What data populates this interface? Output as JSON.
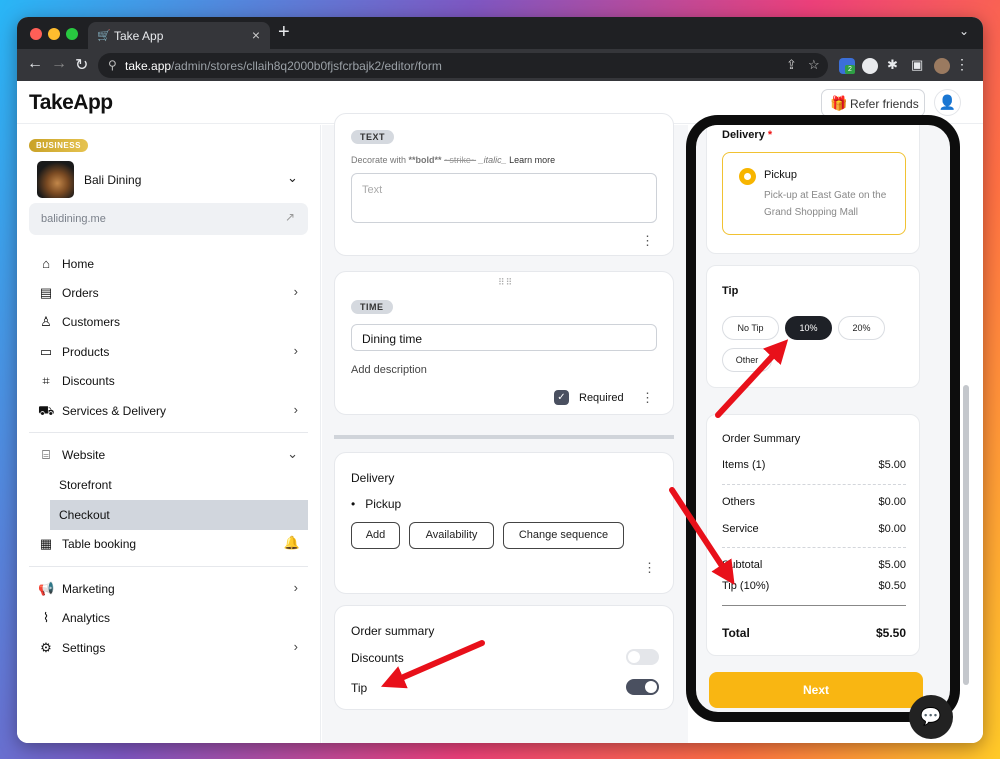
{
  "browser": {
    "tab_title": "Take App",
    "url_host": "take.app",
    "url_path": "/admin/stores/cllaih8q2000b0fjsfcrbajk2/editor/form",
    "new_tab": "+",
    "ext_badge": "2"
  },
  "header": {
    "logo": "TakeApp",
    "refer_label": "Refer friends"
  },
  "sidebar": {
    "plan_badge": "BUSINESS",
    "store_name": "Bali Dining",
    "store_domain": "balidining.me",
    "items": [
      {
        "label": "Home",
        "icon": "home-icon"
      },
      {
        "label": "Orders",
        "icon": "orders-icon"
      },
      {
        "label": "Customers",
        "icon": "person-icon"
      },
      {
        "label": "Products",
        "icon": "box-icon"
      },
      {
        "label": "Discounts",
        "icon": "tag-icon"
      },
      {
        "label": "Services & Delivery",
        "icon": "truck-icon"
      },
      {
        "label": "Website",
        "icon": "store-icon"
      },
      {
        "label": "Storefront"
      },
      {
        "label": "Checkout"
      },
      {
        "label": "Table booking",
        "icon": "calendar-icon"
      },
      {
        "label": "Marketing",
        "icon": "megaphone-icon"
      },
      {
        "label": "Analytics",
        "icon": "chart-icon"
      },
      {
        "label": "Settings",
        "icon": "gear-icon"
      }
    ]
  },
  "editor": {
    "text_card": {
      "chip": "TEXT",
      "hint_prefix": "Decorate with",
      "hint_bold": "**bold**",
      "hint_strike": "~strike~",
      "hint_italic": "_italic_",
      "hint_link": "Learn more",
      "placeholder": "Text"
    },
    "time_card": {
      "chip": "TIME",
      "value": "Dining time",
      "add_description": "Add description",
      "required_label": "Required"
    },
    "delivery_card": {
      "title": "Delivery",
      "option": "Pickup",
      "buttons": [
        "Add",
        "Availability",
        "Change sequence"
      ]
    },
    "summary_card": {
      "title": "Order summary",
      "rows": [
        {
          "label": "Discounts",
          "enabled": false
        },
        {
          "label": "Tip",
          "enabled": true
        }
      ]
    }
  },
  "preview": {
    "delivery": {
      "title": "Delivery",
      "required_mark": "*",
      "option_name": "Pickup",
      "option_desc": "Pick-up at East Gate on the Grand Shopping Mall"
    },
    "tip": {
      "title": "Tip",
      "options": [
        "No Tip",
        "10%",
        "20%",
        "Other"
      ],
      "selected": "10%"
    },
    "summary": {
      "title": "Order Summary",
      "rows": [
        {
          "label": "Items (1)",
          "value": "$5.00"
        },
        {
          "label": "Others",
          "value": "$0.00"
        },
        {
          "label": "Service",
          "value": "$0.00"
        },
        {
          "label": "Subtotal",
          "value": "$5.00"
        },
        {
          "label": "Tip (10%)",
          "value": "$0.50"
        },
        {
          "label": "Total",
          "value": "$5.50"
        }
      ]
    },
    "next_label": "Next"
  },
  "colors": {
    "accent_yellow": "#f9b612",
    "annotation_arrow": "#e8101a",
    "badge_gold": "#c9a227"
  }
}
